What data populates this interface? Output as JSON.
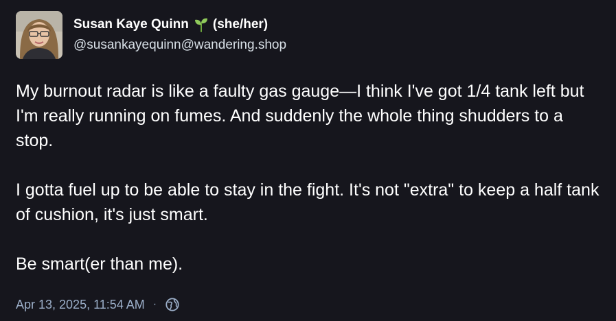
{
  "colors": {
    "background": "#16161d",
    "text": "#ffffff",
    "handle": "#d9e1e8",
    "meta": "#9baec8",
    "sprout": "#8fc95b"
  },
  "author": {
    "display_name": "Susan Kaye Quinn",
    "emoji": "seedling-icon",
    "pronouns": "(she/her)",
    "handle": "@susankayequinn@wandering.shop",
    "avatar": "avatar-photo"
  },
  "post": {
    "paragraphs": [
      "My burnout radar is like a faulty gas gauge—I think I've got 1/4 tank left but I'm really running on fumes. And suddenly the whole thing shudders to a stop.",
      "I gotta fuel up to be able to stay in the fight. It's not \"extra\" to keep a half tank of cushion, it's just smart.",
      "Be smart(er than me)."
    ]
  },
  "meta": {
    "timestamp": "Apr 13, 2025, 11:54 AM",
    "separator": "·",
    "visibility_icon": "globe-icon"
  }
}
